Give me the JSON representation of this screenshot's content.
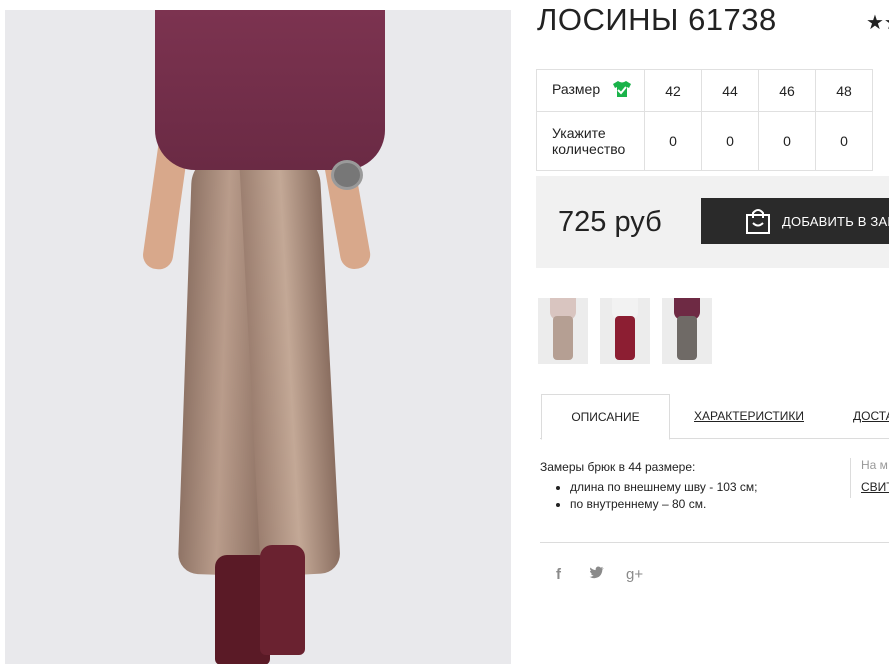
{
  "product": {
    "title": "ЛОСИНЫ 61738",
    "rating_stars": "★★"
  },
  "size_table": {
    "size_label": "Размер",
    "qty_label": "Укажите количество",
    "sizes": [
      "42",
      "44",
      "46",
      "48"
    ],
    "quantities": [
      "0",
      "0",
      "0",
      "0"
    ]
  },
  "purchase": {
    "price": "725 руб",
    "add_button_label": "ДОБАВИТЬ В ЗАКАЗ"
  },
  "tabs": {
    "description": "Описание",
    "specs": "ХАРАКТЕРИСТИКИ",
    "delivery": "ДОСТАВКА"
  },
  "description": {
    "title": "Замеры брюк в 44 размере:",
    "items": [
      "длина по внешнему шву - 103 см;",
      "по внутреннему – 80 см."
    ]
  },
  "side_note": {
    "muted": "На м",
    "link": "СВИТ"
  },
  "social": {
    "facebook": "f",
    "twitter": "t",
    "gplus": "g+"
  },
  "colors": {
    "accent_button": "#2a2a2a",
    "price_panel_bg": "#f1f1f1",
    "tshirt_icon": "#1ab34a"
  }
}
